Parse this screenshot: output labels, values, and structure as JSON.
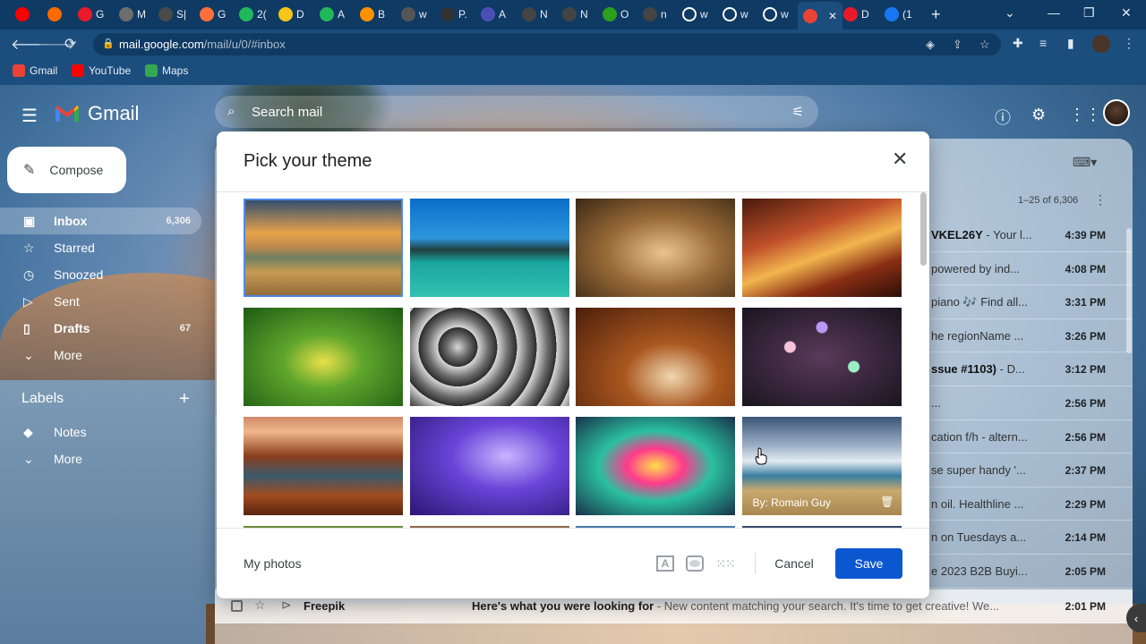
{
  "browser": {
    "tabs": [
      {
        "label": "",
        "color": "#ff0000"
      },
      {
        "label": "",
        "color": "#ff6a00"
      },
      {
        "label": "G",
        "color": "#e81a2a"
      },
      {
        "label": "M",
        "color": "#6d6d6d"
      },
      {
        "label": "S|",
        "color": "#4a4a4a"
      },
      {
        "label": "G",
        "color": "#ff6f3c"
      },
      {
        "label": "2(",
        "color": "#1fb85a"
      },
      {
        "label": "D",
        "color": "#f5c518"
      },
      {
        "label": "A",
        "color": "#1fb85a"
      },
      {
        "label": "B",
        "color": "#ff9100"
      },
      {
        "label": "w",
        "color": "#555555"
      },
      {
        "label": "P.",
        "color": "#333333"
      },
      {
        "label": "A",
        "color": "#4b4fb5"
      },
      {
        "label": "N",
        "color": "#444444"
      },
      {
        "label": "N",
        "color": "#444444"
      },
      {
        "label": "O",
        "color": "#2ca01c"
      },
      {
        "label": "n",
        "color": "#444444"
      },
      {
        "label": "w",
        "color": "#ffffff"
      },
      {
        "label": "w",
        "color": "#ffffff"
      },
      {
        "label": "w",
        "color": "#ffffff"
      },
      {
        "label": "",
        "color": "#ea4335",
        "active": true
      },
      {
        "label": "D",
        "color": "#e81a2a"
      },
      {
        "label": "(1",
        "color": "#1877f2"
      }
    ],
    "url_host": "mail.google.com",
    "url_path": "/mail/u/0/#inbox",
    "bookmarks": [
      {
        "label": "Gmail",
        "color": "#ea4335"
      },
      {
        "label": "YouTube",
        "color": "#ff0000"
      },
      {
        "label": "Maps",
        "color": "#34a853"
      }
    ]
  },
  "gmail": {
    "logo_text": "Gmail",
    "search_placeholder": "Search mail",
    "compose_label": "Compose",
    "nav": [
      {
        "label": "Inbox",
        "count": "6,306",
        "icon": "inbox-icon",
        "selected": true,
        "bold": true
      },
      {
        "label": "Starred",
        "count": "",
        "icon": "star-icon"
      },
      {
        "label": "Snoozed",
        "count": "",
        "icon": "clock-icon"
      },
      {
        "label": "Sent",
        "count": "",
        "icon": "send-icon"
      },
      {
        "label": "Drafts",
        "count": "67",
        "icon": "draft-icon",
        "bold": true
      },
      {
        "label": "More",
        "count": "",
        "icon": "chevron-down-icon"
      }
    ],
    "labels_header": "Labels",
    "labels": [
      {
        "label": "Notes",
        "icon": "label-icon"
      },
      {
        "label": "More",
        "icon": "chevron-down-icon"
      }
    ],
    "pager": "1–25 of 6,306",
    "mails": [
      {
        "snippet_bold": "VKEL26Y",
        "snippet": " - Your l...",
        "time": "4:39 PM"
      },
      {
        "snippet_bold": "",
        "snippet": "powered by ind...",
        "time": "4:08 PM"
      },
      {
        "snippet_bold": "",
        "snippet": "piano 🎶 Find all...",
        "time": "3:31 PM"
      },
      {
        "snippet_bold": "",
        "snippet": "he regionName ...",
        "time": "3:26 PM"
      },
      {
        "snippet_bold": "ssue #1103)",
        "snippet": " - D...",
        "time": "3:12 PM"
      },
      {
        "snippet_bold": "",
        "snippet": "...",
        "time": "2:56 PM"
      },
      {
        "snippet_bold": "",
        "snippet": "cation f/h - altern...",
        "time": "2:56 PM"
      },
      {
        "snippet_bold": "",
        "snippet": "se super handy '...",
        "time": "2:37 PM"
      },
      {
        "snippet_bold": "",
        "snippet": "n oil. Healthline ...",
        "time": "2:29 PM"
      },
      {
        "snippet_bold": "",
        "snippet": "n on Tuesdays a...",
        "time": "2:14 PM"
      },
      {
        "snippet_bold": "",
        "snippet": "e 2023 B2B Buyi...",
        "time": "2:05 PM"
      }
    ],
    "last_mail": {
      "sender": "Freepik",
      "subject": "Here's what you were looking for",
      "snippet": " - New content matching your search. It's time to get creative! We...",
      "time": "2:01 PM"
    }
  },
  "theme_dialog": {
    "title": "Pick your theme",
    "themes": [
      {
        "name": "golden-gate",
        "selected": true
      },
      {
        "name": "lake"
      },
      {
        "name": "chess"
      },
      {
        "name": "canyon-red"
      },
      {
        "name": "caterpillar"
      },
      {
        "name": "pipes"
      },
      {
        "name": "autumn-leaves"
      },
      {
        "name": "bokeh"
      },
      {
        "name": "grand-canyon"
      },
      {
        "name": "jellyfish"
      },
      {
        "name": "colorful-bubble"
      },
      {
        "name": "beach",
        "credit": "By: Romain Guy"
      }
    ],
    "my_photos_label": "My photos",
    "cancel_label": "Cancel",
    "save_label": "Save",
    "text_bg_icon_label": "A"
  }
}
